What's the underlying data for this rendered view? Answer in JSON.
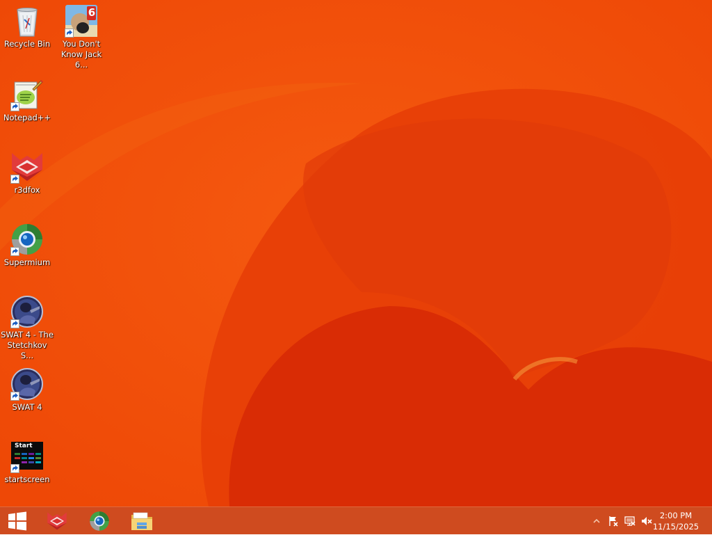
{
  "desktop": {
    "icons": [
      {
        "label": "Recycle Bin",
        "icon": "recycle-bin-icon"
      },
      {
        "label": "You Don't Know Jack 6...",
        "badge": "6",
        "icon": "you-dont-know-jack-icon"
      },
      {
        "label": "Notepad++",
        "icon": "notepad-plus-plus-icon"
      },
      {
        "label": "r3dfox",
        "icon": "r3dfox-icon"
      },
      {
        "label": "Supermium",
        "icon": "supermium-icon"
      },
      {
        "label": "SWAT 4 - The Stetchkov S...",
        "icon": "swat4-expansion-icon"
      },
      {
        "label": "SWAT 4",
        "icon": "swat4-icon"
      },
      {
        "label": "startscreen",
        "tile_text": "Start",
        "icon": "startscreen-icon"
      }
    ]
  },
  "taskbar": {
    "start": {
      "icon": "windows-logo-icon"
    },
    "pinned": [
      {
        "name": "r3dfox",
        "icon": "r3dfox-icon"
      },
      {
        "name": "Supermium",
        "icon": "supermium-icon"
      },
      {
        "name": "File Explorer",
        "icon": "folder-icon"
      }
    ],
    "tray": {
      "icons": [
        "show-hidden-icons-chevron",
        "action-center-flag-icon",
        "network-icon",
        "volume-muted-icon"
      ],
      "time": "2:00 PM",
      "date": "11/15/2025"
    }
  },
  "colors": {
    "wallpaper_base": "#ef4a08",
    "wallpaper_dark": "#d62a06",
    "taskbar": "#cf4b1f"
  }
}
